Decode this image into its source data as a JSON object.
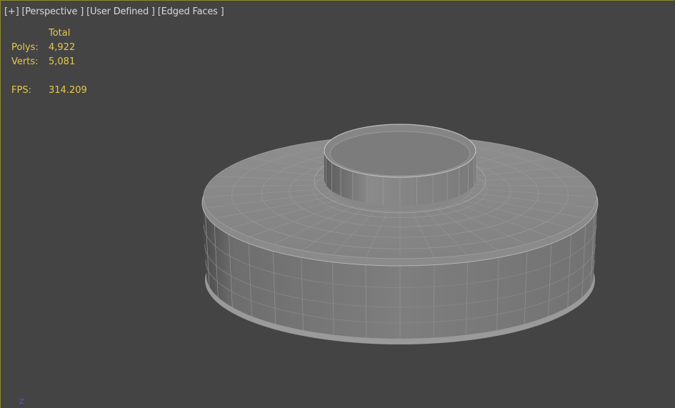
{
  "viewport": {
    "labels": [
      "[+]",
      "[Perspective ]",
      "[User Defined ]",
      "[Edged Faces ]"
    ]
  },
  "stats": {
    "column_header": "Total",
    "polys_label": "Polys:",
    "polys_value": "4,922",
    "verts_label": "Verts:",
    "verts_value": "5,081",
    "fps_label": "FPS:",
    "fps_value": "314.209"
  },
  "axis_tripod": {
    "z_label": "Z"
  },
  "colors": {
    "viewport_bg": "#444444",
    "stat_text": "#e7c84a",
    "label_text": "#d8d8d8",
    "active_border": "#8f8a2e",
    "mesh_top": "#8b8b8b",
    "mesh_side": "#7a7a7a",
    "wire": "#a8a8a8"
  }
}
